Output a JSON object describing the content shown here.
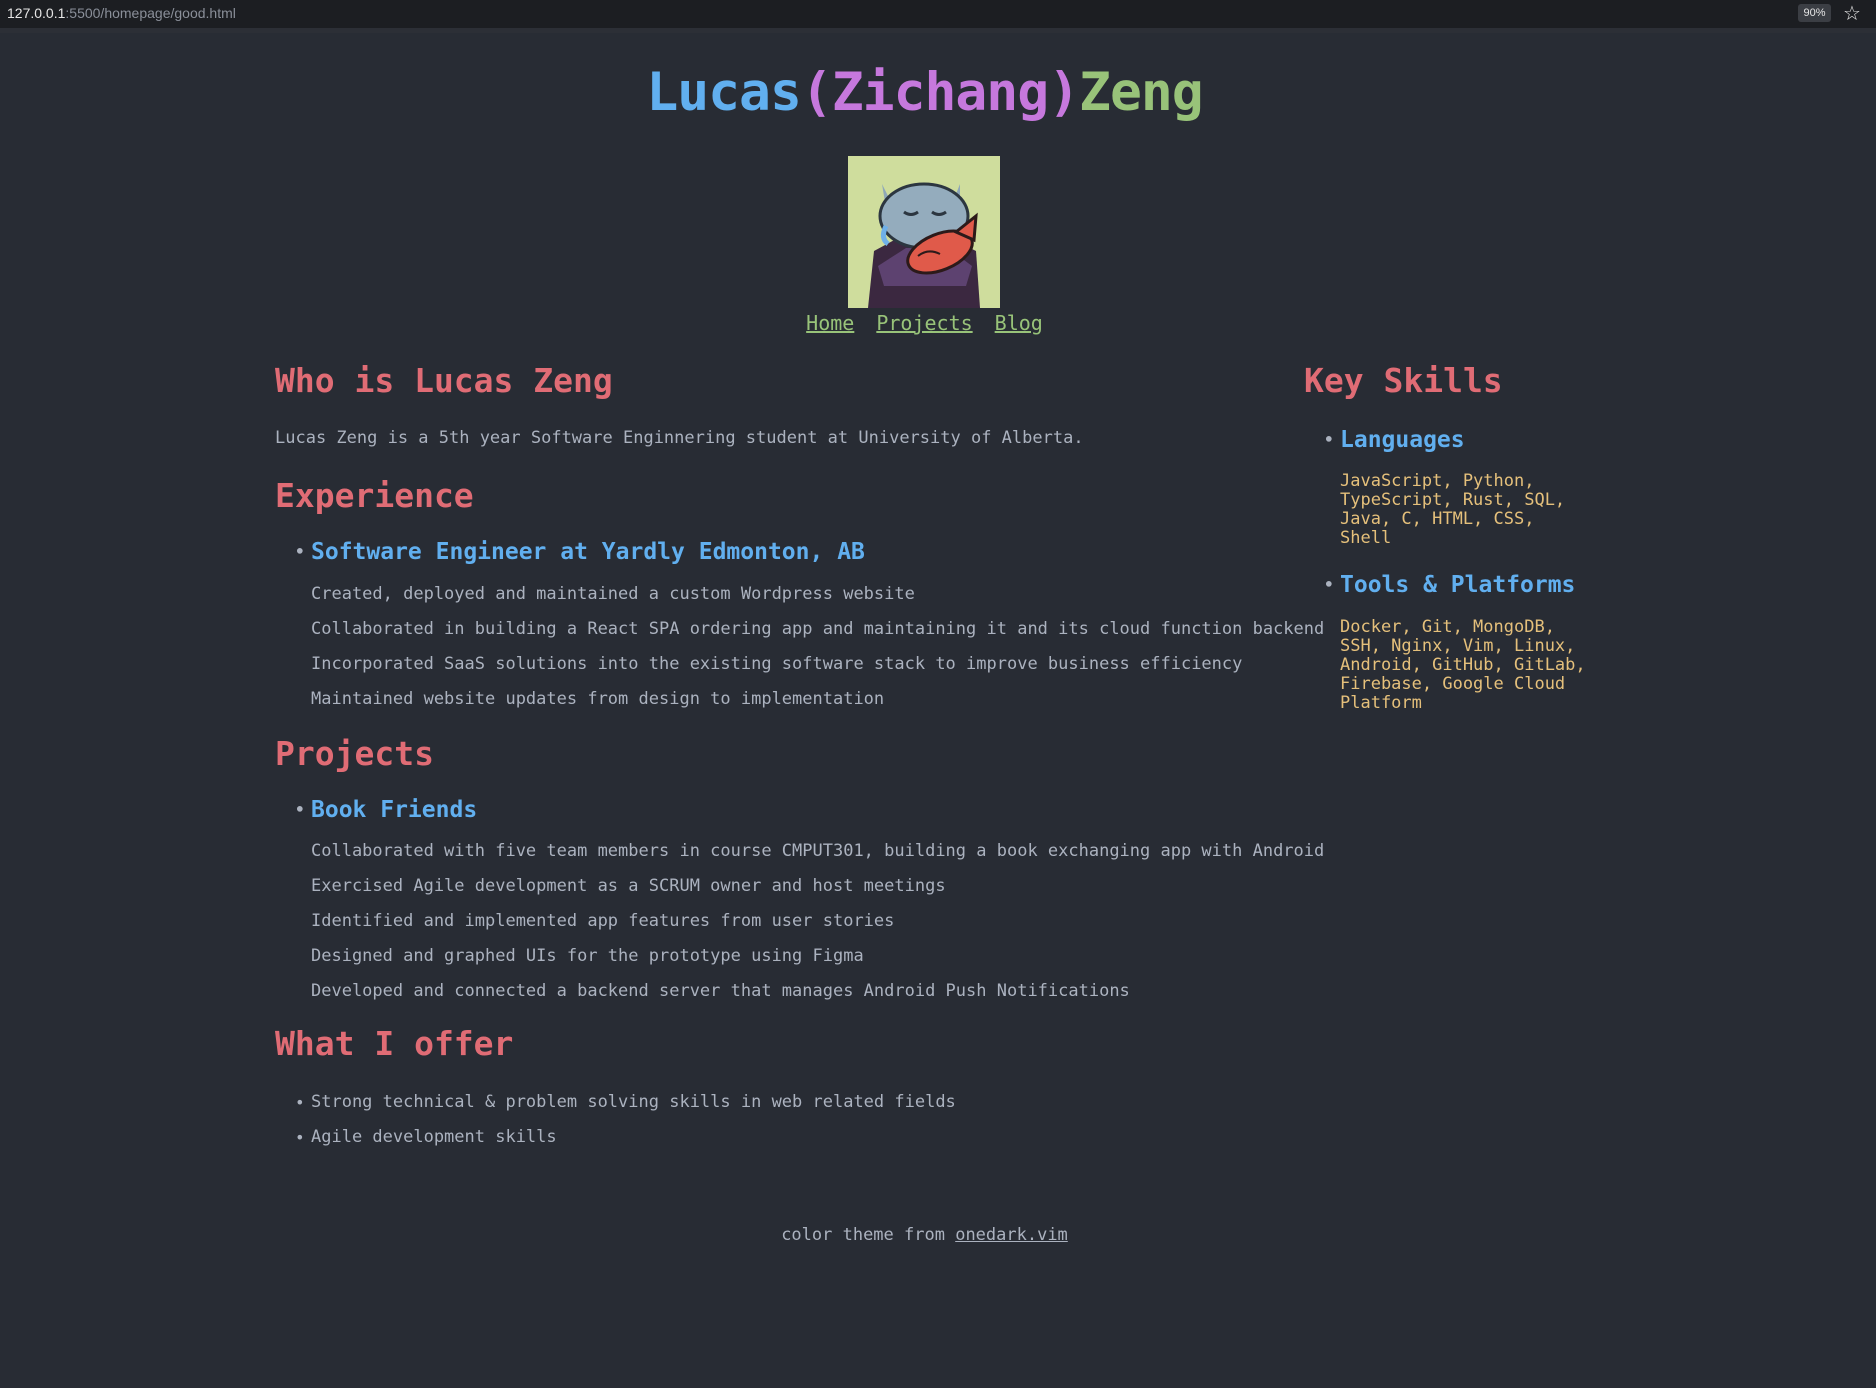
{
  "browser": {
    "url_host": "127.0.0.1",
    "url_rest": ":5500/homepage/good.html",
    "zoom": "90%",
    "star_icon": "star-icon"
  },
  "header": {
    "name_first": "Lucas",
    "name_middle": "(Zichang)",
    "name_last": "Zeng",
    "avatar_icon": "cartoon-cat-eating-fish-avatar"
  },
  "nav": {
    "home": "Home",
    "projects": "Projects",
    "blog": "Blog"
  },
  "about": {
    "heading": "Who is Lucas Zeng",
    "text": "Lucas Zeng is a 5th year Software Enginnering student at University of Alberta."
  },
  "experience": {
    "heading": "Experience",
    "job_title": "Software Engineer at Yardly Edmonton, AB",
    "items": [
      "Created, deployed and maintained a custom Wordpress website",
      "Collaborated in building a React SPA ordering app and maintaining it and its cloud function backend",
      "Incorporated SaaS solutions into the existing software stack to improve business efficiency",
      "Maintained website updates from design to implementation"
    ]
  },
  "projects": {
    "heading": "Projects",
    "project_title": "Book Friends",
    "items": [
      "Collaborated with five team members in course CMPUT301, building a book exchanging app with Android",
      "Exercised Agile development as a SCRUM owner and host meetings",
      "Identified and implemented app features from user stories",
      "Designed and graphed UIs for the prototype using Figma",
      "Developed and connected a backend server that manages Android Push Notifications"
    ]
  },
  "offer": {
    "heading": "What I offer",
    "items": [
      "Strong technical & problem solving skills in web related fields",
      "Agile development skills"
    ]
  },
  "skills": {
    "heading": "Key Skills",
    "languages_title": "Languages",
    "languages_lines": [
      "JavaScript, Python,",
      "TypeScript, Rust, SQL,",
      "Java, C, HTML, CSS,",
      "Shell"
    ],
    "tools_title": "Tools & Platforms",
    "tools_lines": [
      "Docker, Git, MongoDB,",
      "SSH, Nginx, Vim, Linux,",
      "Android, GitHub, GitLab,",
      "Firebase, Google Cloud",
      "Platform"
    ]
  },
  "footer": {
    "text": "color theme from",
    "link": "onedark.vim"
  },
  "colors": {
    "background": "#282c34",
    "text": "#abb2bf",
    "heading_red": "#e06c75",
    "accent_blue": "#61afef",
    "accent_purple": "#c678dd",
    "accent_green": "#98c379",
    "skill_yellow": "#e5c07b"
  }
}
